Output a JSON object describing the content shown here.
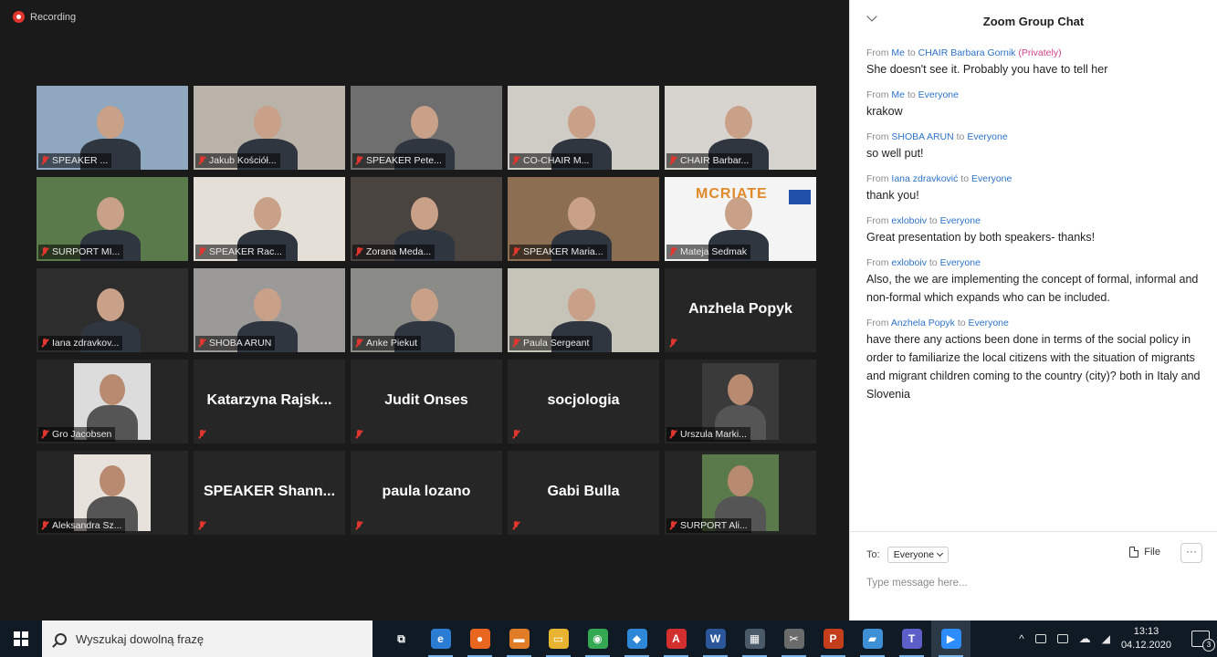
{
  "recording": {
    "label": "Recording"
  },
  "gallery": {
    "tiles": [
      {
        "name": "SPEAKER ...",
        "type": "video",
        "bg": "#8fa8c0"
      },
      {
        "name": "Jakub Kościół...",
        "type": "video",
        "bg": "#b9b3aa"
      },
      {
        "name": "SPEAKER Pete...",
        "type": "video",
        "bg": "#6f6f6f"
      },
      {
        "name": "CO-CHAIR M...",
        "type": "video",
        "bg": "#cfcbc5"
      },
      {
        "name": "CHAIR Barbar...",
        "type": "video",
        "bg": "#d7d4cf"
      },
      {
        "name": "SURPORT MI...",
        "type": "video",
        "bg": "#5b7a4b"
      },
      {
        "name": "SPEAKER Rac...",
        "type": "video",
        "bg": "#e4e0d8"
      },
      {
        "name": "Zorana Meda...",
        "type": "video",
        "bg": "#4a4440"
      },
      {
        "name": "SPEAKER Maria...",
        "type": "video",
        "bg": "#8c6e52"
      },
      {
        "name": "Mateja Sedmak",
        "type": "video",
        "bg": "#f4f4f4",
        "active": true,
        "banner": "MCRIATE"
      },
      {
        "name": "Iana zdravkov...",
        "type": "video",
        "bg": "#2d2d2d"
      },
      {
        "name": "SHOBA ARUN",
        "type": "video",
        "bg": "#9c9a98"
      },
      {
        "name": "Anke Piekut",
        "type": "video",
        "bg": "#8a8a86"
      },
      {
        "name": "Paula Sergeant",
        "type": "video",
        "bg": "#c6c3b9"
      },
      {
        "name": "Anzhela Popyk",
        "type": "name"
      },
      {
        "name": "Gro Jacobsen",
        "type": "photo",
        "bg": "#dcdcdc"
      },
      {
        "name": "Katarzyna Rajsk...",
        "type": "name"
      },
      {
        "name": "Judit Onses",
        "type": "name"
      },
      {
        "name": "socjologia",
        "type": "name"
      },
      {
        "name": "Urszula Marki...",
        "type": "photo",
        "bg": "#3a3a3a"
      },
      {
        "name": "Aleksandra Sz...",
        "type": "photo",
        "bg": "#e8e2dc"
      },
      {
        "name": "SPEAKER Shann...",
        "type": "name"
      },
      {
        "name": "paula lozano",
        "type": "name"
      },
      {
        "name": "Gabi Bulla",
        "type": "name"
      },
      {
        "name": "SURPORT Ali...",
        "type": "photo",
        "bg": "#5b7a4b"
      }
    ]
  },
  "chat": {
    "title": "Zoom Group Chat",
    "messages": [
      {
        "from": "Me",
        "to": "CHAIR Barbara Gornik",
        "privately": "(Privately)",
        "text": "She doesn't see it. Probably you have to tell her"
      },
      {
        "from": "Me",
        "to": "Everyone",
        "text": "krakow"
      },
      {
        "from": "SHOBA ARUN",
        "to": "Everyone",
        "text": "so well put!"
      },
      {
        "from": "Iana zdravković",
        "to": "Everyone",
        "text": "thank you!"
      },
      {
        "from": "exloboiv",
        "to": "Everyone",
        "text": "Great presentation by both speakers- thanks!"
      },
      {
        "from": "exloboiv",
        "to": "Everyone",
        "text": "Also, the we are implementing the concept of formal, informal and non-formal which expands who can be included."
      },
      {
        "from": "Anzhela Popyk",
        "to": "Everyone",
        "text": "have there any actions been done in terms of the social policy in order to familiarize the local citizens with the situation of migrants and migrant children coming to the country (city)? both in Italy and Slovenia"
      }
    ],
    "labels": {
      "from": "From",
      "to": "to"
    },
    "composer": {
      "to_label": "To:",
      "recipient": "Everyone",
      "file_label": "File",
      "more_label": "···",
      "placeholder": "Type message here..."
    }
  },
  "taskbar": {
    "search_placeholder": "Wyszukaj dowolną frazę",
    "time": "13:13",
    "date": "04.12.2020",
    "notifications": "3",
    "apps": [
      {
        "icon": "task-view-icon",
        "glyph": "⧉",
        "color": "#101a24"
      },
      {
        "icon": "edge-icon",
        "glyph": "e",
        "color": "#2b7cd3"
      },
      {
        "icon": "firefox-icon",
        "glyph": "●",
        "color": "#e8661f"
      },
      {
        "icon": "folder-briefcase-icon",
        "glyph": "▬",
        "color": "#e07b26"
      },
      {
        "icon": "file-explorer-icon",
        "glyph": "▭",
        "color": "#e8b330"
      },
      {
        "icon": "chrome-icon",
        "glyph": "◉",
        "color": "#34a853"
      },
      {
        "icon": "drive-icon",
        "glyph": "◆",
        "color": "#2f87d8"
      },
      {
        "icon": "acrobat-icon",
        "glyph": "A",
        "color": "#d32f2f"
      },
      {
        "icon": "word-icon",
        "glyph": "W",
        "color": "#2b579a"
      },
      {
        "icon": "calculator-icon",
        "glyph": "▦",
        "color": "#4a5a68"
      },
      {
        "icon": "screenshot-tool-icon",
        "glyph": "✂",
        "color": "#6a6a6a"
      },
      {
        "icon": "powerpoint-icon",
        "glyph": "P",
        "color": "#c43e1c"
      },
      {
        "icon": "files-app-icon",
        "glyph": "▰",
        "color": "#3d8fd6"
      },
      {
        "icon": "teams-icon",
        "glyph": "T",
        "color": "#5b5fc7"
      },
      {
        "icon": "zoom-icon",
        "glyph": "▶",
        "color": "#2d8cff"
      }
    ]
  }
}
